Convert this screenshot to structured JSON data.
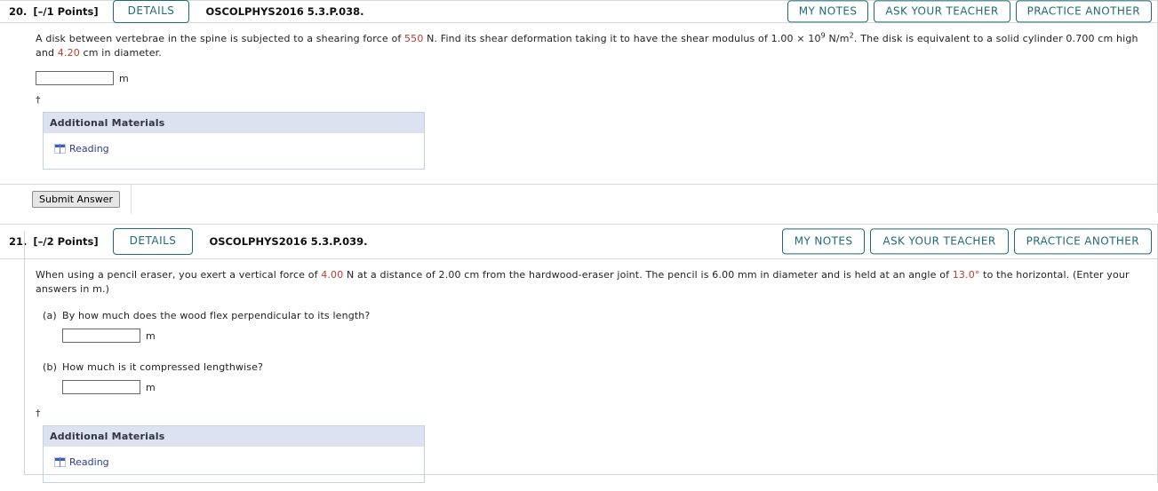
{
  "questions": [
    {
      "number": "20.",
      "points": "[–/1 Points]",
      "details_label": "DETAILS",
      "code": "OSCOLPHYS2016 5.3.P.038.",
      "actions": [
        {
          "label": "MY NOTES",
          "name": "my-notes-button"
        },
        {
          "label": "ASK YOUR TEACHER",
          "name": "ask-your-teacher-button"
        },
        {
          "label": "PRACTICE ANOTHER",
          "name": "practice-another-button"
        }
      ],
      "text_parts": [
        {
          "t": "A disk between vertebrae in the spine is subjected to a shearing force of ",
          "hl": false
        },
        {
          "t": "550",
          "hl": true
        },
        {
          "t": " N. Find its shear deformation taking it to have the shear modulus of 1.00 × 10",
          "hl": false
        },
        {
          "t": "9",
          "sup": true
        },
        {
          "t": " N/m",
          "hl": false
        },
        {
          "t": "2",
          "sup": true
        },
        {
          "t": ". The disk is equivalent to a solid cylinder 0.700 cm high and ",
          "hl": false
        },
        {
          "t": "4.20",
          "hl": true
        },
        {
          "t": " cm in diameter.",
          "hl": false
        }
      ],
      "answer_value": "",
      "answer_placeholder": "",
      "answer_unit": "m",
      "dagger": "†",
      "additional_materials": {
        "title": "Additional Materials",
        "link_label": "Reading",
        "icon": "book-icon"
      },
      "submit_label": "Submit Answer",
      "has_submit": true
    },
    {
      "number": "21.",
      "points": "[–/2 Points]",
      "details_label": "DETAILS",
      "code": "OSCOLPHYS2016 5.3.P.039.",
      "actions": [
        {
          "label": "MY NOTES",
          "name": "my-notes-button"
        },
        {
          "label": "ASK YOUR TEACHER",
          "name": "ask-your-teacher-button"
        },
        {
          "label": "PRACTICE ANOTHER",
          "name": "practice-another-button"
        }
      ],
      "text_parts": [
        {
          "t": "When using a pencil eraser, you exert a vertical force of ",
          "hl": false
        },
        {
          "t": "4.00",
          "hl": true
        },
        {
          "t": " N at a distance of 2.00 cm from the hardwood-eraser joint. The pencil is 6.00 mm in diameter and is held at an angle of ",
          "hl": false
        },
        {
          "t": "13.0°",
          "hl": true
        },
        {
          "t": " to the horizontal. (Enter your answers in m.)",
          "hl": false
        }
      ],
      "parts": [
        {
          "label": "(a)",
          "prompt": "By how much does the wood flex perpendicular to its length?",
          "answer_value": "",
          "answer_unit": "m"
        },
        {
          "label": "(b)",
          "prompt": "How much is it compressed lengthwise?",
          "answer_value": "",
          "answer_unit": "m"
        }
      ],
      "dagger": "†",
      "additional_materials": {
        "title": "Additional Materials",
        "link_label": "Reading",
        "icon": "book-icon"
      },
      "has_submit": false
    }
  ],
  "colors": {
    "accent_teal": "#1f6b73",
    "highlight_value": "#c0392b",
    "materials_header": "#dde2f1",
    "link_blue": "#2b3c8a"
  }
}
